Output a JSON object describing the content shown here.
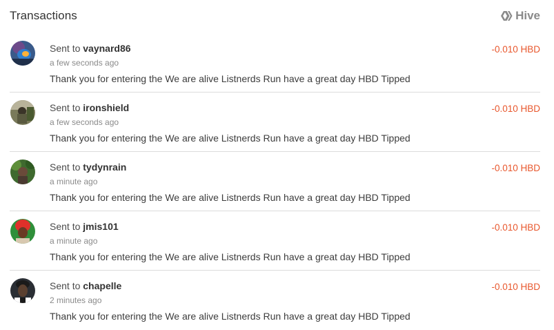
{
  "header": {
    "title": "Transactions",
    "brand_label": "Hive"
  },
  "colors": {
    "amount": "#e8572d",
    "brand": "#8a8a8a",
    "divider": "#dcdcdc"
  },
  "transactions": [
    {
      "prefix": "Sent to",
      "user": "vaynard86",
      "time": "a few seconds ago",
      "memo": "Thank you for entering the We are alive Listnerds Run have a great day HBD Tipped",
      "amount": "-0.010 HBD",
      "avatar_icon": "avatar-blue-figure"
    },
    {
      "prefix": "Sent to",
      "user": "ironshield",
      "time": "a few seconds ago",
      "memo": "Thank you for entering the We are alive Listnerds Run have a great day HBD Tipped",
      "amount": "-0.010 HBD",
      "avatar_icon": "avatar-outdoor-photo"
    },
    {
      "prefix": "Sent to",
      "user": "tydynrain",
      "time": "a minute ago",
      "memo": "Thank you for entering the We are alive Listnerds Run have a great day HBD Tipped",
      "amount": "-0.010 HBD",
      "avatar_icon": "avatar-green-forest"
    },
    {
      "prefix": "Sent to",
      "user": "jmis101",
      "time": "a minute ago",
      "memo": "Thank you for entering the We are alive Listnerds Run have a great day HBD Tipped",
      "amount": "-0.010 HBD",
      "avatar_icon": "avatar-red-headwrap"
    },
    {
      "prefix": "Sent to",
      "user": "chapelle",
      "time": "2 minutes ago",
      "memo": "Thank you for entering the We are alive Listnerds Run have a great day HBD Tipped",
      "amount": "-0.010 HBD",
      "avatar_icon": "avatar-dark-portrait"
    }
  ]
}
